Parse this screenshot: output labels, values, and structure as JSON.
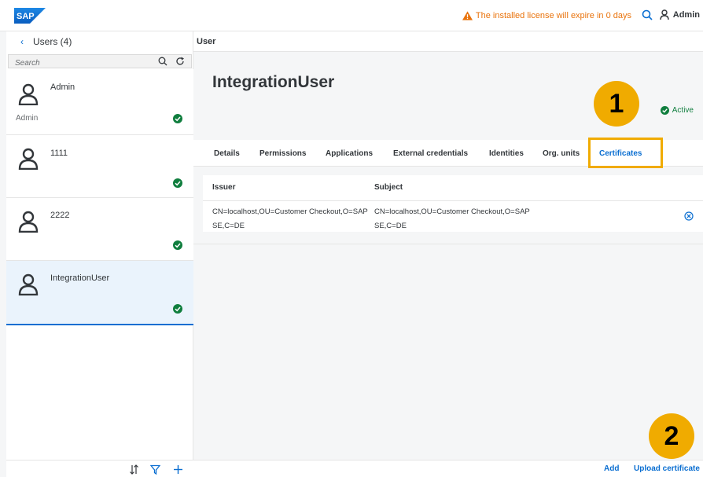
{
  "shell": {
    "logo_text": "SAP",
    "license_warning": "The installed license will expire in 0 days",
    "user_name": "Admin"
  },
  "master": {
    "title": "Users (4)",
    "search_placeholder": "Search",
    "users": [
      {
        "name": "Admin",
        "sub": "Admin"
      },
      {
        "name": "1111",
        "sub": ""
      },
      {
        "name": "2222",
        "sub": ""
      },
      {
        "name": "IntegrationUser",
        "sub": ""
      }
    ]
  },
  "detail": {
    "bar_title": "User",
    "object_title": "IntegrationUser",
    "status": "Active",
    "tabs": [
      "Details",
      "Permissions",
      "Applications",
      "External credentials",
      "Identities",
      "Org. units",
      "Certificates"
    ],
    "table": {
      "columns": [
        "Issuer",
        "Subject"
      ],
      "rows": [
        {
          "issuer": "CN=localhost,OU=Customer Checkout,O=SAP SE,C=DE",
          "subject": "CN=localhost,OU=Customer Checkout,O=SAP SE,C=DE"
        }
      ]
    },
    "footer": {
      "add": "Add",
      "upload": "Upload certificate"
    }
  },
  "callouts": {
    "one": "1",
    "two": "2"
  },
  "colors": {
    "accent": "#0a6ed1",
    "callout": "#f0ab00",
    "success": "#107e3e",
    "warning": "#e9730c"
  }
}
